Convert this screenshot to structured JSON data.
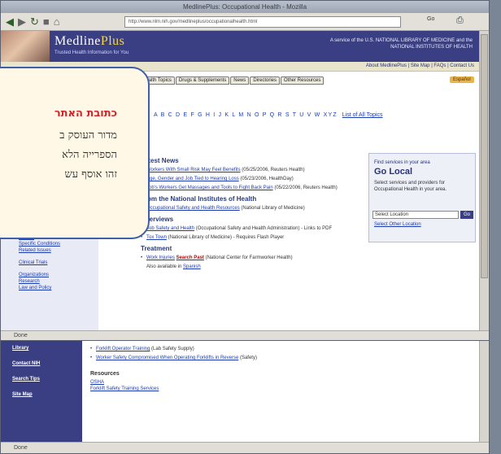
{
  "browser": {
    "title": "MedlinePlus: Occupational Health - Mozilla",
    "url": "http://www.nlm.nih.gov/medlineplus/occupationalhealth.html",
    "go_label": "Go",
    "status_top": "Done",
    "status_bottom": "Done"
  },
  "site": {
    "logo_main": "Medline",
    "logo_plus": "Plus",
    "tagline": "Trusted Health Information for You",
    "nih_text": "A service of the U.S. NATIONAL LIBRARY OF MEDICINE and the NATIONAL INSTITUTES OF HEALTH",
    "utility_links": "About MedlinePlus | Site Map | FAQs | Contact Us",
    "tabs": [
      "Health Topics",
      "Drugs & Supplements",
      "News",
      "Directories",
      "Other Resources"
    ],
    "espanol": "Español",
    "alphabet": "A B C D E F G H I J K L M N O P Q R S T U V W XYZ",
    "alphabet_all": "List of All Topics"
  },
  "sidebar_links": [
    "Coping",
    "Specific Conditions",
    "Related Issues",
    "Clinical Trials",
    "Organizations",
    "Research",
    "Law and Policy"
  ],
  "main": {
    "latest_news_heading": "Latest News",
    "news": [
      {
        "link": "Workers With Small Risk May Feel Benefits",
        "rest": " (05/25/2006, Reuters Health)"
      },
      {
        "link": "Age, Gender and Job Tied to Hearing Loss",
        "rest": " (05/23/2006, HealthDay)"
      },
      {
        "link": "Job's Workers Get Massages and Tools to Fight Back Pain",
        "rest": " (05/22/2006, Reuters Health)"
      }
    ],
    "nih_heading": "From the National Institutes of Health",
    "nih_items": [
      {
        "link": "Occupational Safety and Health Resources",
        "rest": " (National Library of Medicine)"
      }
    ],
    "overviews_heading": "Overviews",
    "overviews": [
      {
        "link": "Job Safety and Health",
        "rest": " (Occupational Safety and Health Administration) - Links to PDF"
      },
      {
        "link": "Tox Town",
        "rest": " (National Library of Medicine) - Requires Flash Player"
      }
    ],
    "treatment_heading": "Treatment",
    "treatment_link": "Work Injuries",
    "treatment_badge": "Search Past",
    "treatment_rest": " (National Center for Farmworker Health)",
    "also_available": "Also available in",
    "also_available_link": "Spanish"
  },
  "go_local": {
    "header": "Find services in your area",
    "title": "Go Local",
    "text": "Select services and providers for Occupational Health in your area.",
    "select_value": "Select Location",
    "go_label": "Go",
    "link": "Select Other Location"
  },
  "window2": {
    "nav": [
      "Library",
      "Contact NIH",
      "Search Tips",
      "Site Map"
    ],
    "items": [
      {
        "link": "Forklift Operator Training",
        "rest": " (Lab Safety Supply)"
      },
      {
        "link": "Worker Safety Compromised When Operating Forklifts in Reverse",
        "rest": " (Safety)"
      }
    ],
    "resources_heading": "Resources",
    "resource_links": [
      "OSHA",
      "Forklift Safety Training Services"
    ]
  },
  "callout": {
    "heading": "כתובת האתר",
    "lines": [
      "מדור העוסק ב",
      "הספרייה הלא",
      "זהו אוסף עש"
    ]
  }
}
